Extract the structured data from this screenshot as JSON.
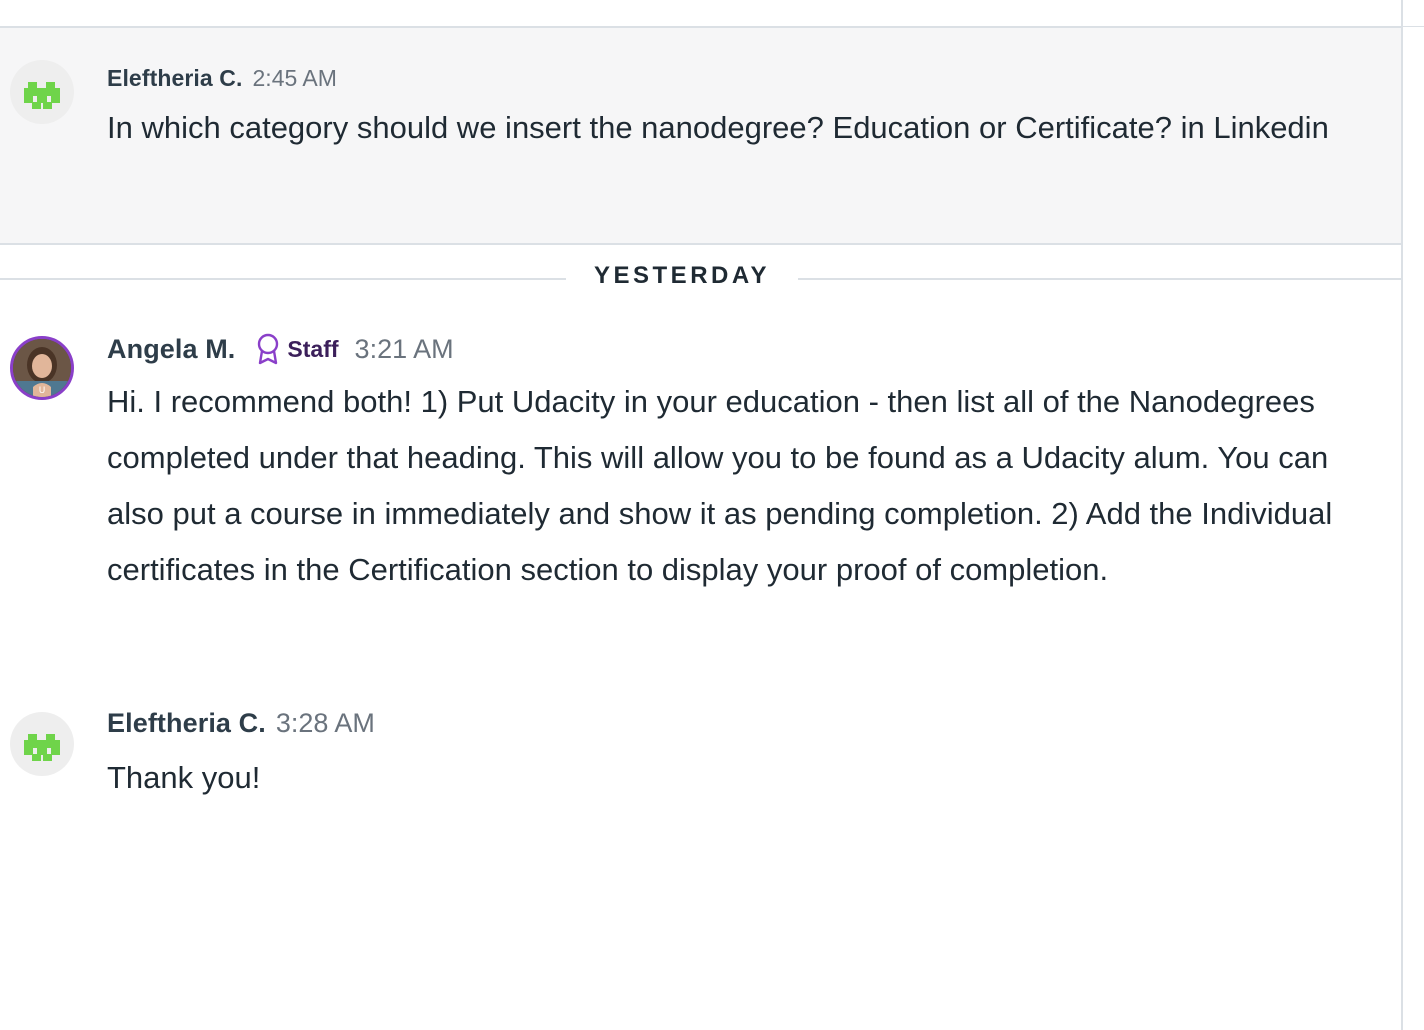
{
  "divider": {
    "label": "YESTERDAY"
  },
  "messages": [
    {
      "author": "Eleftheria C.",
      "time": "2:45 AM",
      "text": "In which category should we insert the nanodegree? Education or Certificate? in Linkedin",
      "avatar_icon": "pixel-avatar-icon",
      "highlighted": true
    },
    {
      "author": "Angela M.",
      "badge": "Staff",
      "badge_icon": "award-ribbon-icon",
      "time": "3:21 AM",
      "text": "Hi. I recommend both! 1) Put Udacity in your education - then list all of the Nanodegrees completed under that heading. This will allow you to be found as a Udacity alum. You can also put a course in immediately and show it as pending completion. 2) Add the Individual certificates in the Certification section to display your proof of completion.",
      "avatar_icon": "profile-photo-avatar",
      "highlighted": false
    },
    {
      "author": "Eleftheria C.",
      "time": "3:28 AM",
      "text": "Thank you!",
      "avatar_icon": "pixel-avatar-icon",
      "highlighted": false
    }
  ],
  "colors": {
    "avatar_green": "#6fd44a",
    "staff_purple": "#8a3fc9",
    "highlight_bg": "#f6f6f7",
    "rule": "#dbe0e5"
  }
}
